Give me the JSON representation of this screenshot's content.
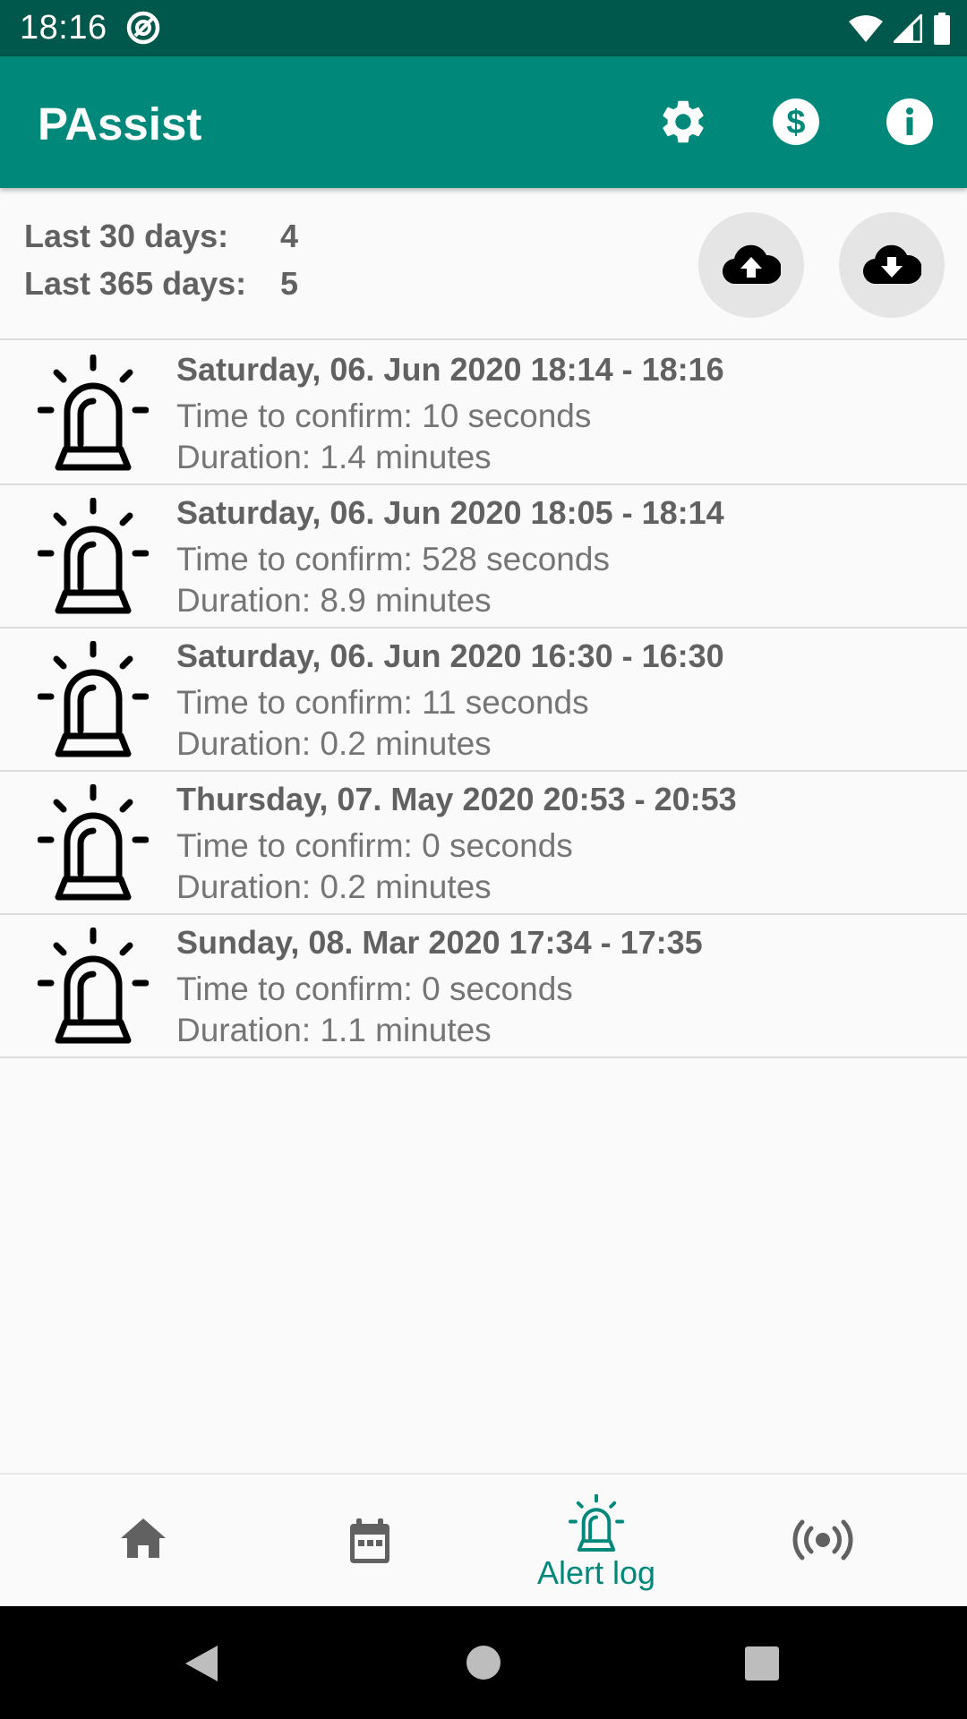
{
  "status_bar": {
    "time": "18:16"
  },
  "app_bar": {
    "title": "PAssist",
    "actions": [
      "settings-icon",
      "dollar-icon",
      "info-icon"
    ]
  },
  "summary": {
    "last30_label": "Last 30 days:",
    "last30_value": "4",
    "last365_label": "Last 365 days:",
    "last365_value": "5",
    "buttons": [
      "cloud-upload-icon",
      "cloud-download-icon"
    ]
  },
  "alerts": [
    {
      "title": "Saturday, 06. Jun 2020 18:14 - 18:16",
      "confirm": "Time to confirm: 10 seconds",
      "duration": "Duration: 1.4 minutes"
    },
    {
      "title": "Saturday, 06. Jun 2020 18:05 - 18:14",
      "confirm": "Time to confirm: 528 seconds",
      "duration": "Duration: 8.9 minutes"
    },
    {
      "title": "Saturday, 06. Jun 2020 16:30 - 16:30",
      "confirm": "Time to confirm: 11 seconds",
      "duration": "Duration: 0.2 minutes"
    },
    {
      "title": "Thursday, 07. May 2020 20:53 - 20:53",
      "confirm": "Time to confirm: 0 seconds",
      "duration": "Duration: 0.2 minutes"
    },
    {
      "title": "Sunday, 08. Mar 2020 17:34 - 17:35",
      "confirm": "Time to confirm: 0 seconds",
      "duration": "Duration: 1.1 minutes"
    }
  ],
  "bottom_nav": {
    "items": [
      {
        "icon": "home-icon",
        "label": ""
      },
      {
        "icon": "calendar-icon",
        "label": ""
      },
      {
        "icon": "alarm-light-icon",
        "label": "Alert log",
        "active": true
      },
      {
        "icon": "broadcast-icon",
        "label": ""
      }
    ]
  },
  "colors": {
    "primary": "#00897b",
    "primary_dark": "#00574b",
    "text_primary": "#616161",
    "text_secondary": "#757575"
  }
}
